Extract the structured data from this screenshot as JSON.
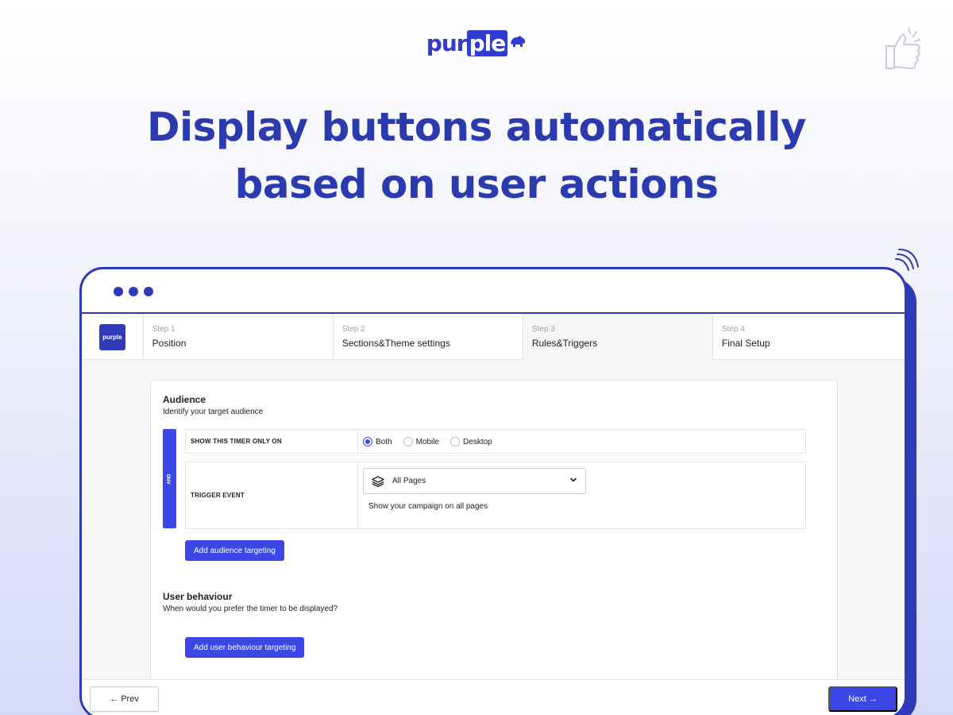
{
  "brand": {
    "logo_text_a": "pur",
    "logo_text_b": "ple",
    "accent": "#2f3ab8",
    "button": "#3c48e6"
  },
  "hero": {
    "line1": "Display buttons automatically",
    "line2": "based on user actions"
  },
  "stepper": {
    "logo_text": "purple",
    "steps": [
      {
        "num": "Step 1",
        "label": "Position"
      },
      {
        "num": "Step 2",
        "label": "Sections&Theme settings"
      },
      {
        "num": "Step 3",
        "label": "Rules&Triggers"
      },
      {
        "num": "Step 4",
        "label": "Final Setup"
      }
    ],
    "active_step": 3
  },
  "audience": {
    "title": "Audience",
    "subtitle": "Identify your target audience",
    "and_label": "AND",
    "device_rule": {
      "label": "SHOW THIS TIMER ONLY ON",
      "options": [
        "Both",
        "Mobile",
        "Desktop"
      ],
      "selected": "Both"
    },
    "trigger_rule": {
      "label": "TRIGGER EVENT",
      "select_value": "All Pages",
      "help_text": "Show your campaign on all pages"
    },
    "add_button": "Add audience targeting"
  },
  "behaviour": {
    "title": "User behaviour",
    "subtitle": "When would you prefer the timer to be displayed?",
    "add_button": "Add user behaviour targeting"
  },
  "footer": {
    "prev_label": "← Prev",
    "next_label": "Next →"
  },
  "icons": [
    "bear-icon",
    "layers-icon",
    "chevron-down-icon",
    "thumbs-up-icon",
    "signal-icon"
  ]
}
